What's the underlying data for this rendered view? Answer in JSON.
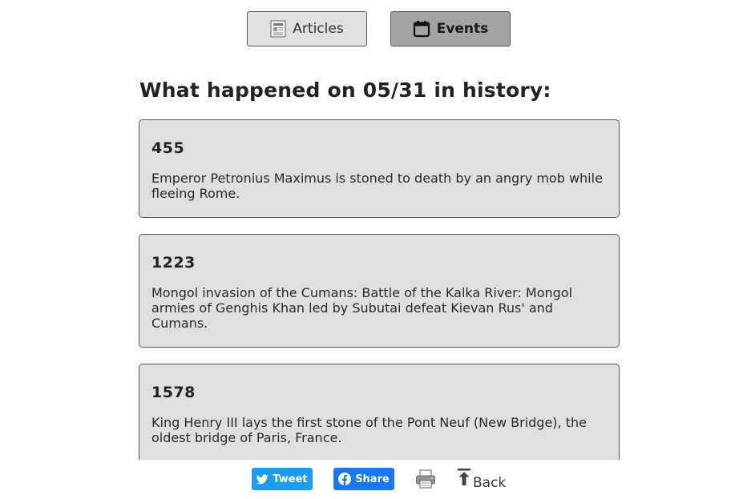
{
  "tabs": {
    "articles_label": "Articles",
    "events_label": "Events"
  },
  "heading": "What happened on 05/31 in history:",
  "events": [
    {
      "year": "455",
      "text": "Emperor Petronius Maximus is stoned to death by an angry mob while fleeing Rome."
    },
    {
      "year": "1223",
      "text": "Mongol invasion of the Cumans: Battle of the Kalka River: Mongol armies of Genghis Khan led by Subutai defeat Kievan Rus' and Cumans."
    },
    {
      "year": "1578",
      "text": "King Henry III lays the first stone of the Pont Neuf (New Bridge), the oldest bridge of Paris, France."
    }
  ],
  "footer": {
    "tweet_label": "Tweet",
    "share_label": "Share",
    "back_label": "Back"
  },
  "colors": {
    "tweet": "#1d9bf0",
    "share": "#1877f2",
    "active_tab": "#a3a3a3",
    "inactive_tab": "#e0e0e0",
    "card": "#dfdfdf"
  },
  "icons": {
    "articles": "newspaper-icon",
    "events": "calendar-icon",
    "tweet": "twitter-bird-icon",
    "share": "facebook-icon",
    "print": "printer-icon",
    "back": "arrow-up-to-top-icon"
  }
}
